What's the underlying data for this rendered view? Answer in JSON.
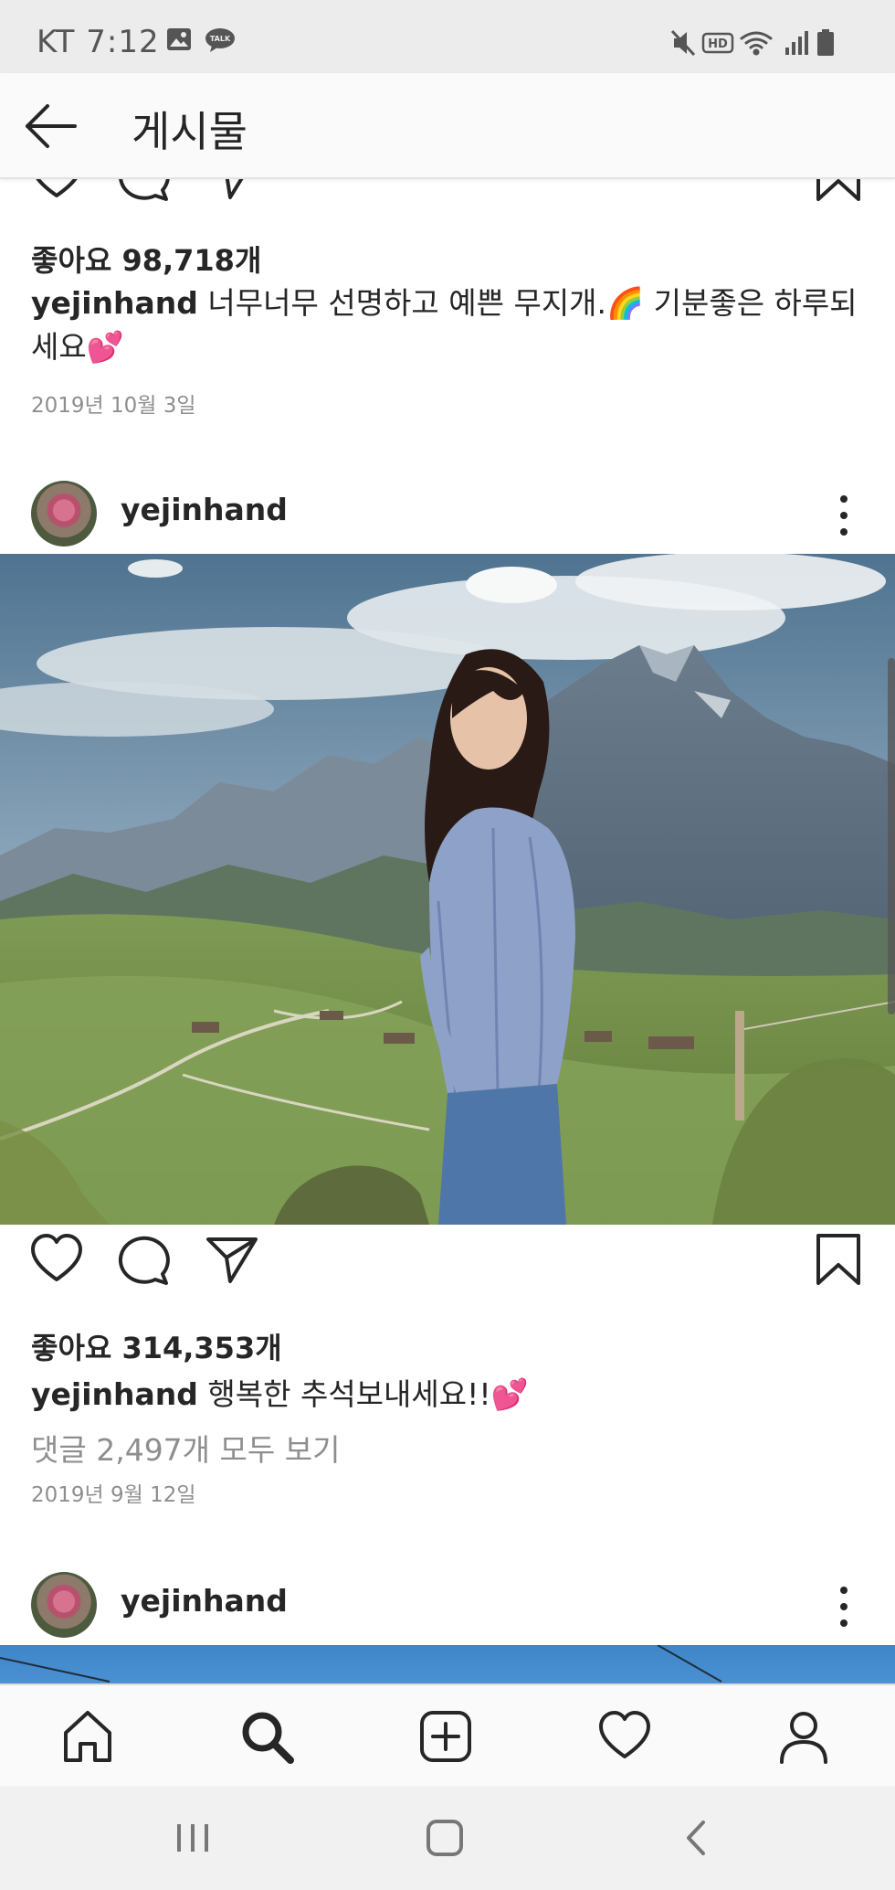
{
  "status_bar": {
    "carrier_time": "KT 7:12",
    "talk_badge": "TALK",
    "hd_badge": "HD",
    "icons": [
      "gallery-icon",
      "kakaotalk-icon",
      "mute-icon",
      "hd-icon",
      "wifi-icon",
      "signal-icon",
      "battery-icon"
    ]
  },
  "app_bar": {
    "title": "게시물",
    "back_icon": "arrow-left-icon"
  },
  "posts": [
    {
      "likes": "좋아요 98,718개",
      "username": "yejinhand",
      "caption": "너무너무 선명하고 예쁜 무지개.🌈 기분좋은 하루되세요💕",
      "date": "2019년 10월 3일"
    },
    {
      "username": "yejinhand",
      "likes": "좋아요 314,353개",
      "caption": "행복한 추석보내세요!!💕",
      "view_comments": "댓글 2,497개 모두 보기",
      "date": "2019년 9월 12일"
    },
    {
      "username": "yejinhand"
    }
  ],
  "bottom_nav": {
    "items": [
      "home-icon",
      "search-icon",
      "add-post-icon",
      "activity-heart-icon",
      "profile-icon"
    ],
    "active": "search-icon"
  },
  "system_nav": {
    "items": [
      "recent-apps-icon",
      "home-button-icon",
      "back-icon"
    ]
  },
  "colors": {
    "text": "#262626",
    "secondary_text": "#8e8e8e",
    "status_bar_bg": "#ececec",
    "nav_bg": "#fafafa"
  }
}
